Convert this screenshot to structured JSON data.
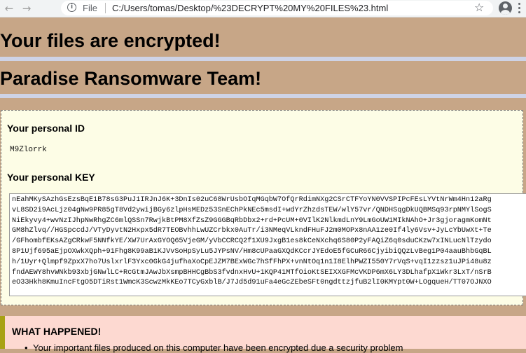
{
  "browser": {
    "back_icon": "←",
    "forward_icon": "→",
    "info_icon": "i",
    "scheme_label": "File",
    "url": "C:/Users/tomas/Desktop/%23DECRYPT%20MY%20FILES%23.html",
    "star_icon": "☆"
  },
  "page": {
    "headline_1": "Your files are encrypted!",
    "headline_2": "Paradise Ransomware Team!",
    "personal_id_label": "Your personal ID",
    "personal_id": "M9Zlorrk",
    "personal_key_label": "Your personal KEY",
    "key_lines": [
      "nEahMKySAzhGsEzsBqE1B78sG3PuJ1IRJnJ6K+3DnIs02uC68WrUsbOIqMGqbW7OfQrRdimNXg2CSrCTFYoYN0VVSPIPcFEsLYVtNrWm4Hn12aRg",
      "vL8SD2i9AcLjz04gNw9PR85gT8Vd2ywijBGy6zlpHsMEDz53SnEChPkNEc5msdI+wdYrZhzdsTEW/wlY57vr/QNDHSqgDkUQBMSq93rpNMYlSogS",
      "NiEkyvy4+wvNzIJhpNwRhgZC6mlQSSn7RwjkBtPM8XfZsZ9GGGBqRbDbx2+rd+PcUM+0VIlK2NlkmdLnY9LmGoUW1MIkNAhO+Jr3gjoragmKomNt",
      "GM8hZlvq//HGSpccdJ/VTyDyvtN2Hxpx5dR7TEOBvhhLwUZCrbkx0AuTr/i3NMeqVLkndFHuFJ2m0MOPx8nAA1ze0If4ly6Vsv+JyLcYbUwXt+Te",
      "/GFhombfEKsAZgCRkwF5NNfkYE/XW7UrAxGYOQ65VjeGM/yVbCCRCQ2f1XU9JxgB1es8kCeNXchq6S80P2yFAQiZ6q0sduCKzw7xINLucNlTzydo",
      "8P1Ujf695aEjpOXwkXQph+91Fhg8K99aB1KJVvSoHpSyLu5JYPsNV/Hm8cUPaaGXQdKCcrJYEdoE5fGCuR66CjyibiQQzLvBeg1P04aauBhbGqBL",
      "h/1Uyr+Qlmpf9ZpxX7ho7UslxrlF3Yxc0GkG4jufhaXoCpEJZM7BExWGc7hSfFhPX+vnNtOq1n1I8ElhPWZI550Y7rVqS+vqI1zzsz1uJPi48u8z",
      "fndAEWY8hvWNkb93xbjGNwlLC+RcGtmJAwJbXsmpBHHCgBbS3fvdnxHvU+1KQP41MTfOioKtSEIXXGFMcVKDP6mX6LY3DLhafpX1Wkr3LxT/nSrB",
      "eO33Hkh8KmuIncFtgO5DTiRst1WmcK3ScwzMkKEo7TCyGxblB/J7Jd5d91uFa4eGcZEbeSFt0ngdttzjfuB2lI0KMYpt0W+LOgqueH/TT07OJNXO"
    ],
    "what_happened_title": "WHAT HAPPENED!",
    "what_happened_item": "Your important files produced on this computer have been encrypted due a security problem"
  },
  "colors": {
    "page_background": "#c7a687",
    "rule": "#ced3e6",
    "panel_background": "#fdfde6",
    "alert_background": "#fdd9d1",
    "alert_border": "#a8a214"
  }
}
